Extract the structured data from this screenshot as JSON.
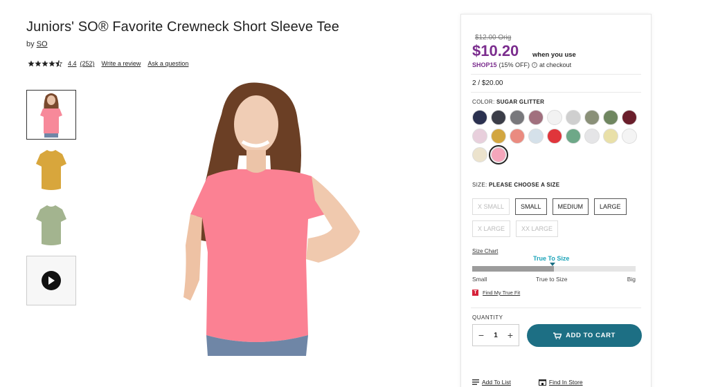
{
  "product": {
    "title": "Juniors' SO® Favorite Crewneck Short Sleeve Tee",
    "by_prefix": "by",
    "brand": "SO",
    "rating": "4.4",
    "review_count": "(252)",
    "write_review": "Write a review",
    "ask_question": "Ask a question"
  },
  "gallery": {
    "thumbnails": [
      {
        "name": "pink-tee-model",
        "active": true
      },
      {
        "name": "mustard-tee",
        "active": false
      },
      {
        "name": "sage-tee",
        "active": false
      },
      {
        "name": "video",
        "active": false
      }
    ]
  },
  "pricing": {
    "original": "$12.00 Orig",
    "sale": "$10.20",
    "when_you_use": "when you use",
    "promo_code": "SHOP15",
    "promo_detail": "(15% OFF)",
    "promo_suffix": "at checkout",
    "deal": "2 / $20.00"
  },
  "color": {
    "label": "COLOR:",
    "selected": "SUGAR GLITTER",
    "swatches": [
      "#2b3150",
      "#3b3d48",
      "#78787c",
      "#a1707e",
      "#f2f2f2",
      "#cfcfcf",
      "#8a9078",
      "#6f8660",
      "#6a1e2b",
      "#e8cfdc",
      "#d2a640",
      "#ea8b80",
      "#d5e1ea",
      "#e0353b",
      "#6ea888",
      "#e5e5e7",
      "#e9e0a8",
      "#f4f4f4",
      "#ece3cd",
      "#f5a6bb"
    ],
    "selected_index": 19
  },
  "size": {
    "label": "SIZE:",
    "prompt": "PLEASE CHOOSE A SIZE",
    "options": [
      {
        "label": "X SMALL",
        "available": false
      },
      {
        "label": "SMALL",
        "available": true
      },
      {
        "label": "MEDIUM",
        "available": true
      },
      {
        "label": "LARGE",
        "available": true
      },
      {
        "label": "X LARGE",
        "available": false
      },
      {
        "label": "XX LARGE",
        "available": false
      }
    ],
    "chart_link": "Size Chart",
    "true_to_size_title": "True To Size",
    "fit_level": 0.5,
    "scale_labels": [
      "Small",
      "True to Size",
      "Big"
    ],
    "find_fit": "Find My True Fit"
  },
  "cart": {
    "qty_label": "QUANTITY",
    "qty": "1",
    "minus": "−",
    "plus": "+",
    "add_to_cart": "ADD TO CART"
  },
  "links": {
    "add_to_list": "Add To List",
    "find_in_store": "Find In Store"
  },
  "colors": {
    "accent_purple": "#7b2d8e",
    "cart_teal": "#1d6f84",
    "fit_teal": "#1aa3b8"
  }
}
